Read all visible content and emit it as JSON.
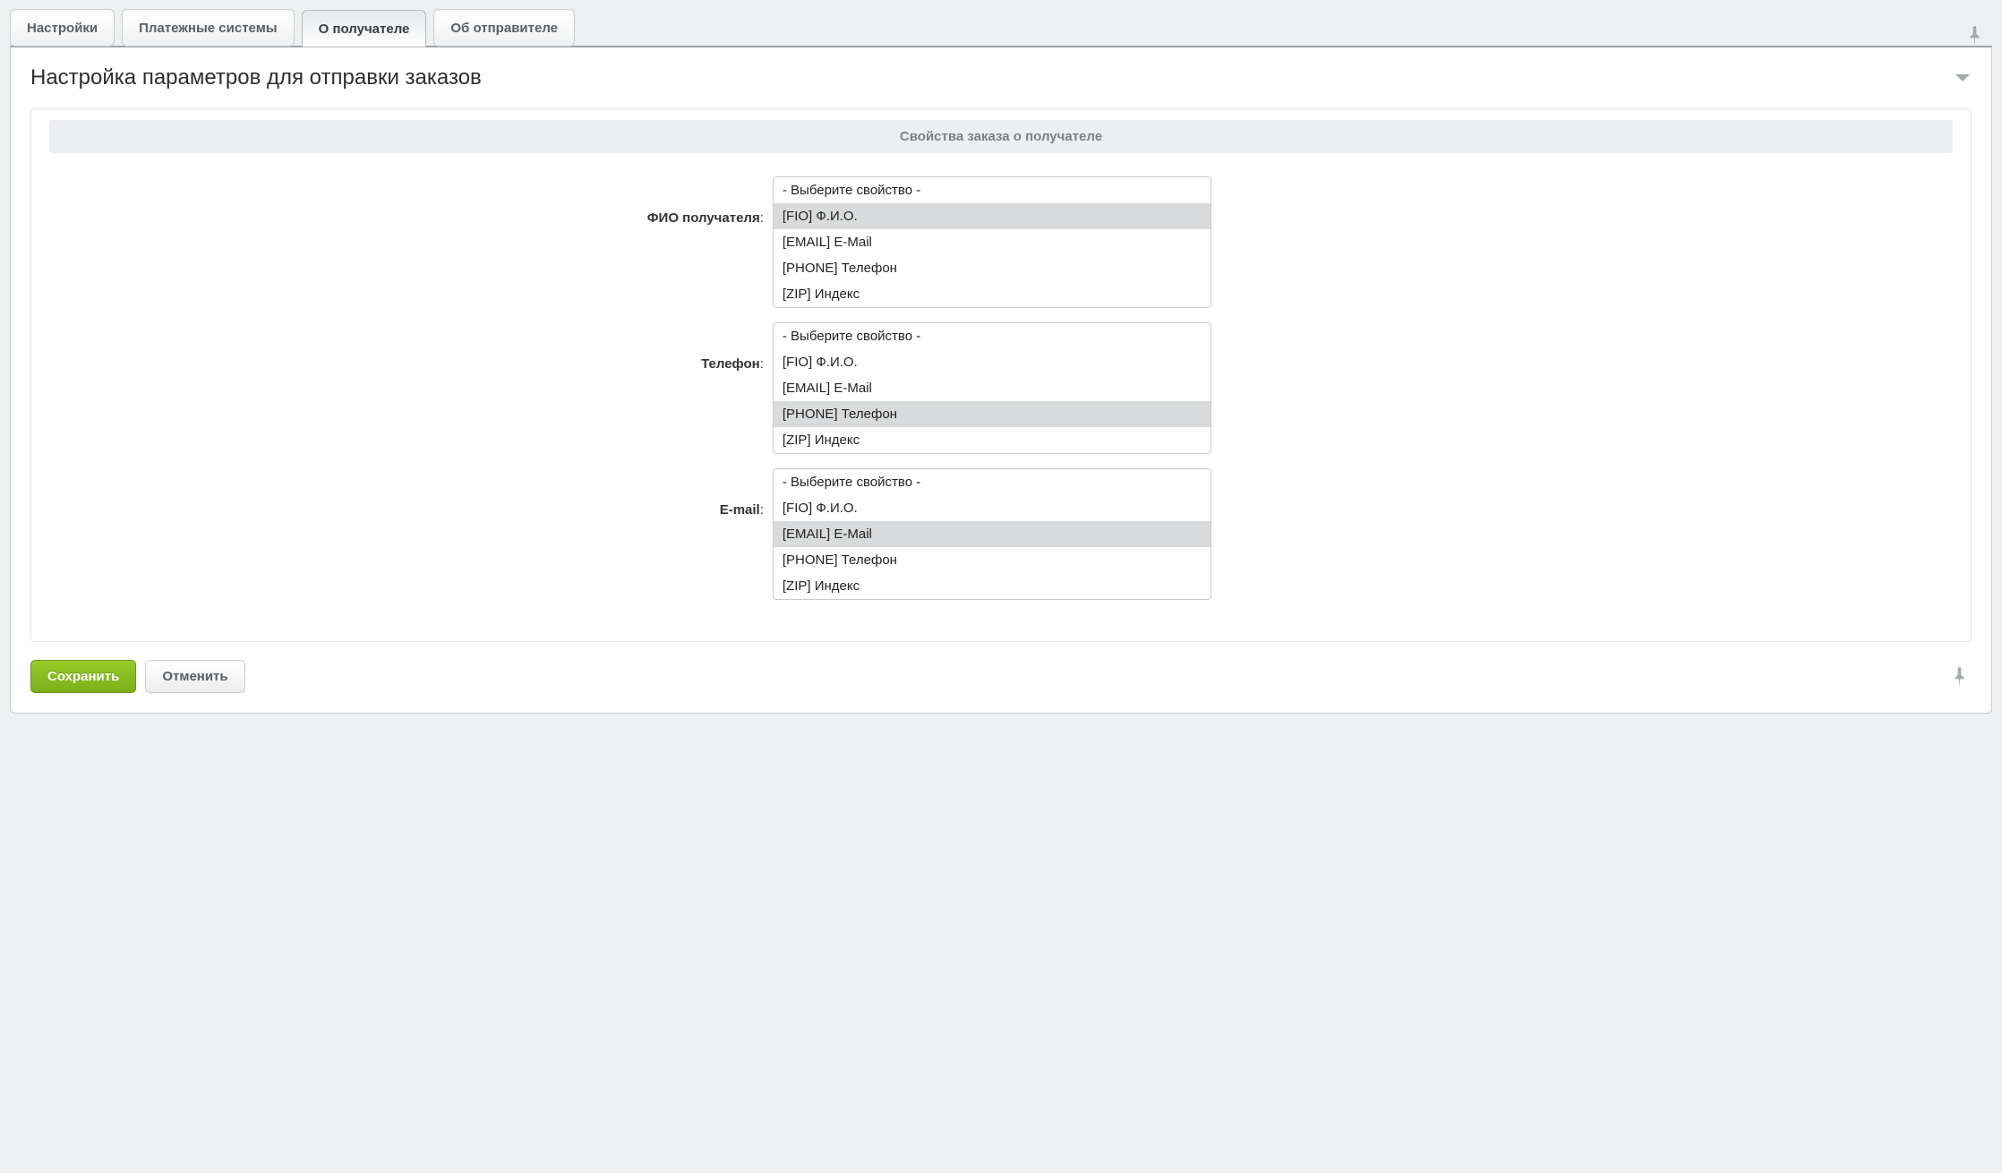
{
  "tabs": [
    {
      "label": "Настройки"
    },
    {
      "label": "Платежные системы"
    },
    {
      "label": "О получателе"
    },
    {
      "label": "Об отправителе"
    }
  ],
  "active_tab_index": 2,
  "panel": {
    "title": "Настройка параметров для отправки заказов",
    "section_title": "Свойства заказа о получателе"
  },
  "property_options": [
    "- Выберите свойство -",
    "[FIO] Ф.И.О.",
    "[EMAIL] E-Mail",
    "[PHONE] Телефон",
    "[ZIP] Индекс"
  ],
  "fields": [
    {
      "label": "ФИО получателя",
      "selected_index": 1
    },
    {
      "label": "Телефон",
      "selected_index": 3
    },
    {
      "label": "E-mail",
      "selected_index": 2
    }
  ],
  "buttons": {
    "save": "Сохранить",
    "cancel": "Отменить"
  }
}
